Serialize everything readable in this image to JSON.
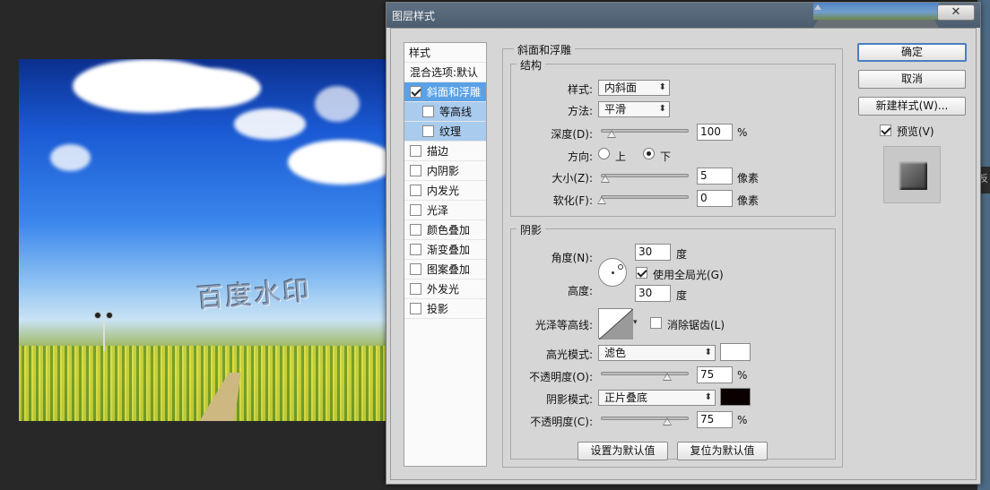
{
  "dialog": {
    "title": "图层样式",
    "close_label": "✕"
  },
  "background": {
    "watermark_text": "百度水印"
  },
  "style_list": {
    "header": "样式",
    "blend_options": "混合选项:默认",
    "items": [
      {
        "label": "斜面和浮雕",
        "checked": true,
        "selected": true
      },
      {
        "label": "等高线",
        "checked": false,
        "sub": true
      },
      {
        "label": "纹理",
        "checked": false,
        "sub": true
      },
      {
        "label": "描边",
        "checked": false
      },
      {
        "label": "内阴影",
        "checked": false
      },
      {
        "label": "内发光",
        "checked": false
      },
      {
        "label": "光泽",
        "checked": false
      },
      {
        "label": "颜色叠加",
        "checked": false
      },
      {
        "label": "渐变叠加",
        "checked": false
      },
      {
        "label": "图案叠加",
        "checked": false
      },
      {
        "label": "外发光",
        "checked": false
      },
      {
        "label": "投影",
        "checked": false
      }
    ]
  },
  "bevel": {
    "section_title": "斜面和浮雕",
    "structure": {
      "title": "结构",
      "style_label": "样式:",
      "style_value": "内斜面",
      "method_label": "方法:",
      "method_value": "平滑",
      "depth_label": "深度(D):",
      "depth_value": "100",
      "depth_unit": "%",
      "depth_fraction": 0.1,
      "direction_label": "方向:",
      "direction_up": "上",
      "direction_down": "下",
      "direction_selected": "下",
      "size_label": "大小(Z):",
      "size_value": "5",
      "size_unit": "像素",
      "soften_label": "软化(F):",
      "soften_value": "0",
      "soften_unit": "像素"
    },
    "shading": {
      "title": "阴影",
      "angle_label": "角度(N):",
      "angle_value": "30",
      "angle_unit": "度",
      "global_light_label": "使用全局光(G)",
      "global_light_checked": true,
      "altitude_label": "高度:",
      "altitude_value": "30",
      "altitude_unit": "度",
      "gloss_contour_label": "光泽等高线:",
      "anti_alias_label": "消除锯齿(L)",
      "anti_alias_checked": false,
      "highlight_mode_label": "高光模式:",
      "highlight_mode_value": "滤色",
      "highlight_color": "#ffffff",
      "highlight_opacity_label": "不透明度(O):",
      "highlight_opacity_value": "75",
      "highlight_opacity_unit": "%",
      "shadow_mode_label": "阴影模式:",
      "shadow_mode_value": "正片叠底",
      "shadow_color": "#0a0000",
      "shadow_opacity_label": "不透明度(C):",
      "shadow_opacity_value": "75",
      "shadow_opacity_unit": "%"
    },
    "make_default_label": "设置为默认值",
    "reset_default_label": "复位为默认值"
  },
  "actions": {
    "ok_label": "确定",
    "cancel_label": "取消",
    "new_style_label": "新建样式(W)...",
    "preview_label": "预览(V)",
    "preview_checked": true
  }
}
